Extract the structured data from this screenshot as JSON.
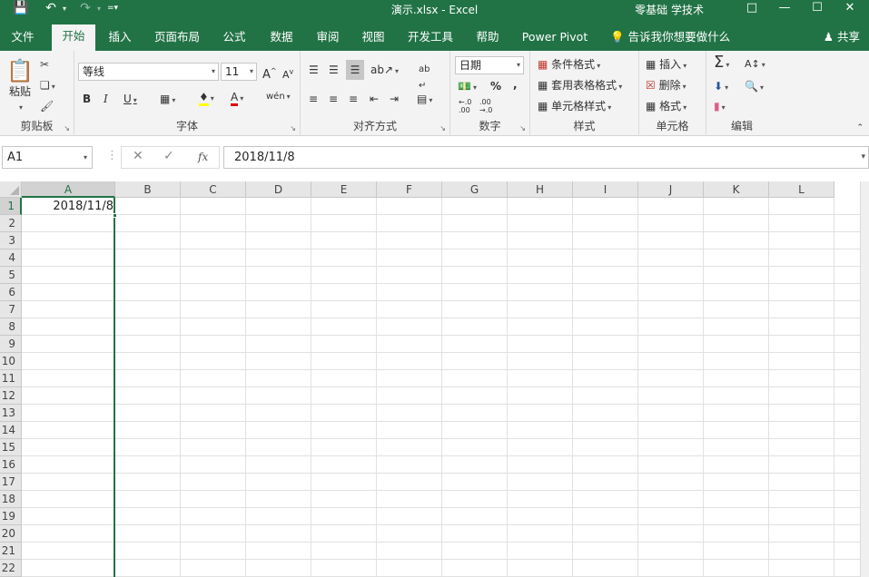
{
  "titlebar": {
    "title": "演示.xlsx  -  Excel",
    "user": "零基础 学技术"
  },
  "tabs": [
    "文件",
    "开始",
    "插入",
    "页面布局",
    "公式",
    "数据",
    "审阅",
    "视图",
    "开发工具",
    "帮助",
    "Power Pivot"
  ],
  "active_tab": "开始",
  "tellme": "告诉我你想要做什么",
  "share": "共享",
  "ribbon": {
    "clipboard": {
      "label": "剪贴板",
      "paste": "粘贴"
    },
    "font": {
      "label": "字体",
      "font_name": "等线",
      "font_size": "11"
    },
    "alignment": {
      "label": "对齐方式"
    },
    "number": {
      "label": "数字",
      "format": "日期"
    },
    "styles": {
      "label": "样式",
      "conditional": "条件格式",
      "table": "套用表格格式",
      "cell": "单元格样式"
    },
    "cells": {
      "label": "单元格",
      "insert": "插入",
      "delete": "删除",
      "format": "格式"
    },
    "editing": {
      "label": "编辑"
    }
  },
  "formula_bar": {
    "name_box": "A1",
    "fx": "fx",
    "content": "2018/11/8"
  },
  "grid": {
    "columns": [
      "A",
      "B",
      "C",
      "D",
      "E",
      "F",
      "G",
      "H",
      "I",
      "J",
      "K",
      "L"
    ],
    "rows": [
      "1",
      "2",
      "3",
      "4",
      "5",
      "6",
      "7",
      "8",
      "9",
      "10",
      "11",
      "12",
      "13",
      "14",
      "15",
      "16",
      "17",
      "18",
      "19",
      "20",
      "21",
      "22"
    ],
    "selected_column": "A",
    "cells": {
      "A1": "2018/11/8"
    }
  },
  "colors": {
    "accent": "#217346"
  }
}
